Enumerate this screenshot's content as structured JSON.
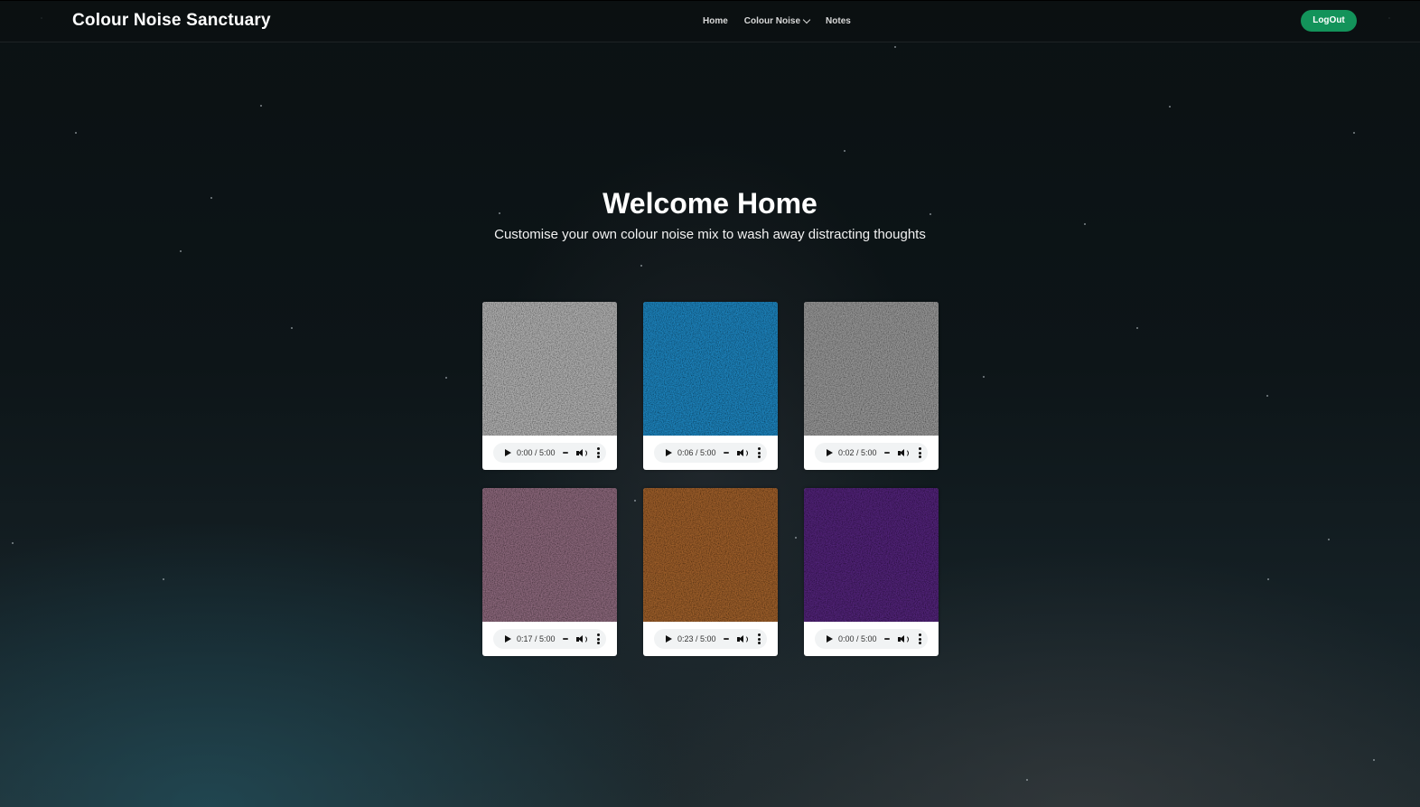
{
  "header": {
    "brand": "Colour Noise Sanctuary",
    "nav": [
      {
        "label": "Home"
      },
      {
        "label": "Colour Noise",
        "has_dropdown": true
      },
      {
        "label": "Notes"
      }
    ],
    "logout_label": "LogOut",
    "logout_color": "#13935a"
  },
  "hero": {
    "title": "Welcome Home",
    "subtitle": "Customise your own colour noise mix to wash away distracting thoughts"
  },
  "tracks": [
    {
      "color": "#b3b3b3",
      "icon": "white-noise-image",
      "time": "0:00 / 5:00"
    },
    {
      "color": "#1f86c0",
      "icon": "blue-noise-image",
      "time": "0:06 / 5:00"
    },
    {
      "color": "#9a9a9a",
      "icon": "grey-noise-image",
      "time": "0:02 / 5:00"
    },
    {
      "color": "#8e6a7e",
      "icon": "pink-noise-image",
      "time": "0:17 / 5:00"
    },
    {
      "color": "#a0612c",
      "icon": "brown-noise-image",
      "time": "0:23 / 5:00"
    },
    {
      "color": "#53257a",
      "icon": "violet-noise-image",
      "time": "0:00 / 5:00"
    }
  ],
  "player_icons": {
    "play": "play-icon",
    "volume": "volume-icon",
    "more": "more-options-icon"
  }
}
